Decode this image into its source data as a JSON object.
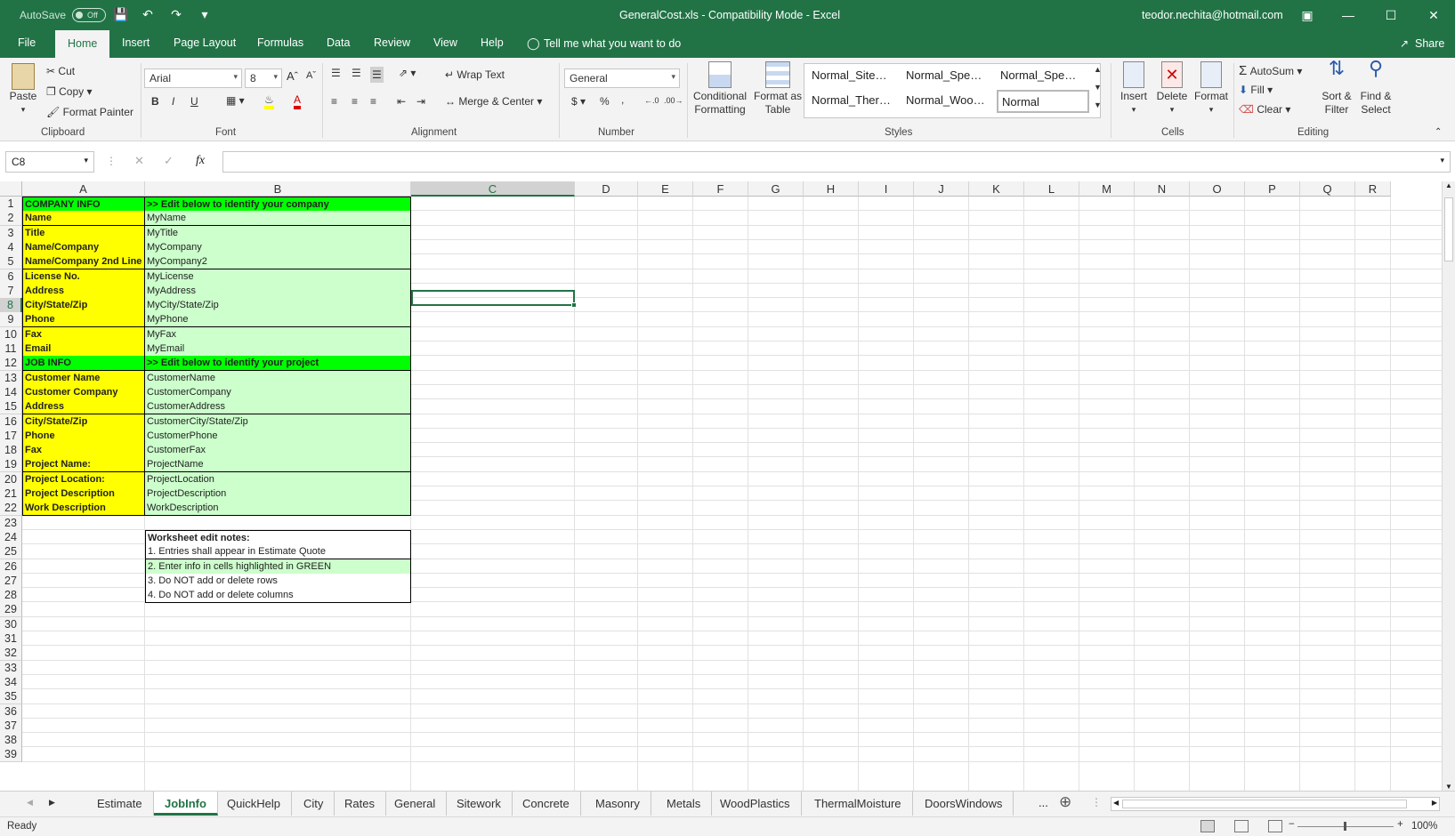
{
  "titlebar": {
    "autosave": "AutoSave",
    "autosave_state": "Off",
    "title": "GeneralCost.xls  -  Compatibility Mode  -  Excel",
    "user": "teodor.nechita@hotmail.com"
  },
  "tabs": [
    "File",
    "Home",
    "Insert",
    "Page Layout",
    "Formulas",
    "Data",
    "Review",
    "View",
    "Help"
  ],
  "tell_me": "Tell me what you want to do",
  "share": "Share",
  "ribbon": {
    "clipboard": {
      "paste": "Paste",
      "cut": "Cut",
      "copy": "Copy",
      "format_painter": "Format Painter",
      "label": "Clipboard"
    },
    "font": {
      "name": "Arial",
      "size": "8",
      "label": "Font",
      "bold": "B",
      "italic": "I",
      "underline": "U"
    },
    "alignment": {
      "wrap": "Wrap Text",
      "merge": "Merge & Center",
      "label": "Alignment"
    },
    "number": {
      "format": "General",
      "currency": "$",
      "percent": "%",
      "comma": ",",
      "label": "Number"
    },
    "styles": {
      "conditional": "Conditional Formatting",
      "format_table": "Format as Table",
      "cells": [
        "Normal_Site…",
        "Normal_Spe…",
        "Normal_Spe…",
        "Normal_Ther…",
        "Normal_Woo…",
        "Normal"
      ],
      "label": "Styles"
    },
    "cells": {
      "insert": "Insert",
      "delete": "Delete",
      "format": "Format",
      "label": "Cells"
    },
    "editing": {
      "autosum": "AutoSum",
      "fill": "Fill",
      "clear": "Clear",
      "sort": "Sort & Filter",
      "find": "Find & Select",
      "label": "Editing"
    }
  },
  "namebox": "C8",
  "fx": "fx",
  "columns": [
    "A",
    "B",
    "C",
    "D",
    "E",
    "F",
    "G",
    "H",
    "I",
    "J",
    "K",
    "L",
    "M",
    "N",
    "O",
    "P",
    "Q",
    "R"
  ],
  "rows": [
    "1",
    "2",
    "3",
    "4",
    "5",
    "6",
    "7",
    "8",
    "9",
    "10",
    "11",
    "12",
    "13",
    "14",
    "15",
    "16",
    "17",
    "18",
    "19",
    "20",
    "21",
    "22",
    "23",
    "24",
    "25",
    "26",
    "27",
    "28",
    "29",
    "30",
    "31",
    "32",
    "33",
    "34",
    "35",
    "36",
    "37",
    "38",
    "39"
  ],
  "data_rows": [
    {
      "a": "COMPANY INFO",
      "b": ">> Edit below to identify your company",
      "section": true
    },
    {
      "a": "Name",
      "b": "MyName"
    },
    {
      "a": "Title",
      "b": "MyTitle"
    },
    {
      "a": "Name/Company",
      "b": "MyCompany"
    },
    {
      "a": "Name/Company 2nd Line",
      "b": "MyCompany2"
    },
    {
      "a": "License No.",
      "b": "MyLicense"
    },
    {
      "a": "Address",
      "b": "MyAddress"
    },
    {
      "a": "City/State/Zip",
      "b": "MyCity/State/Zip"
    },
    {
      "a": "Phone",
      "b": "MyPhone"
    },
    {
      "a": "Fax",
      "b": "MyFax"
    },
    {
      "a": "Email",
      "b": "MyEmail"
    },
    {
      "a": "JOB INFO",
      "b": ">> Edit below to identify your project",
      "section": true
    },
    {
      "a": "Customer Name",
      "b": "CustomerName"
    },
    {
      "a": "Customer Company",
      "b": "CustomerCompany"
    },
    {
      "a": "Address",
      "b": "CustomerAddress"
    },
    {
      "a": "City/State/Zip",
      "b": "CustomerCity/State/Zip"
    },
    {
      "a": "Phone",
      "b": "CustomerPhone"
    },
    {
      "a": "Fax",
      "b": "CustomerFax"
    },
    {
      "a": "Project Name:",
      "b": "ProjectName"
    },
    {
      "a": "Project Location:",
      "b": "ProjectLocation"
    },
    {
      "a": "Project Description",
      "b": "ProjectDescription"
    },
    {
      "a": "Work Description",
      "b": "WorkDescription"
    }
  ],
  "notes": [
    "Worksheet edit notes:",
    "1. Entries shall appear in Estimate Quote",
    "2. Enter info in cells highlighted in GREEN",
    "3. Do NOT add or delete rows",
    "4. Do NOT add or delete columns"
  ],
  "sheets": [
    "Estimate",
    "JobInfo",
    "QuickHelp",
    "City",
    "Rates",
    "General",
    "Sitework",
    "Concrete",
    "Masonry",
    "Metals",
    "WoodPlastics",
    "ThermalMoisture",
    "DoorsWindows"
  ],
  "active_sheet": "JobInfo",
  "more_sheets": "...",
  "status": {
    "ready": "Ready",
    "zoom": "100%"
  },
  "colors": {
    "accent": "#217346",
    "yellow": "#ffff00",
    "green": "#00ff00",
    "lightgreen": "#ccffcc"
  }
}
